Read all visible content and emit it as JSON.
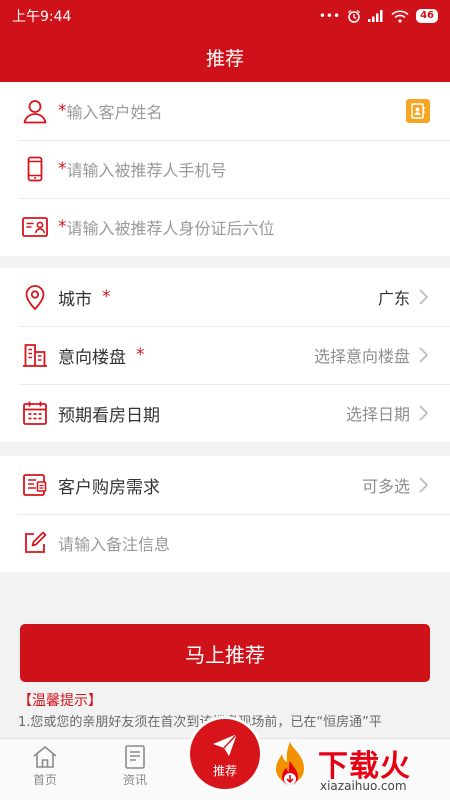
{
  "status_bar": {
    "time": "上午9:44",
    "dots": "•••",
    "battery": "46"
  },
  "header": {
    "title": "推荐"
  },
  "form": {
    "required_mark": "*",
    "name_placeholder": "输入客户姓名",
    "phone_placeholder": "请输入被推荐人手机号",
    "id_placeholder": "请输入被推荐人身份证后六位",
    "city_label": "城市",
    "city_value": "广东",
    "property_label": "意向楼盘",
    "property_value": "选择意向楼盘",
    "date_label": "预期看房日期",
    "date_value": "选择日期",
    "demand_label": "客户购房需求",
    "demand_value": "可多选",
    "remark_placeholder": "请输入备注信息"
  },
  "submit_label": "马上推荐",
  "tips": {
    "title": "【温馨提示】",
    "text": "1.您或您的亲朋好友须在首次到该楼盘现场前，已在“恒房通”平"
  },
  "tabbar": {
    "home_label": "首页",
    "news_label": "资讯",
    "recommend_label": "推荐"
  },
  "watermark": {
    "name": "下载火",
    "url": "xiazaihuo.com"
  },
  "colors": {
    "brand_red": "#cf1219",
    "contact_orange": "#f5a623"
  },
  "icons": {
    "name_row": "person-icon",
    "phone_row": "phone-icon",
    "id_row": "id-card-icon",
    "city_row": "location-pin-icon",
    "property_row": "building-icon",
    "date_row": "calendar-icon",
    "demand_row": "form-list-icon",
    "remark_row": "edit-icon",
    "contact": "contact-book-icon"
  }
}
